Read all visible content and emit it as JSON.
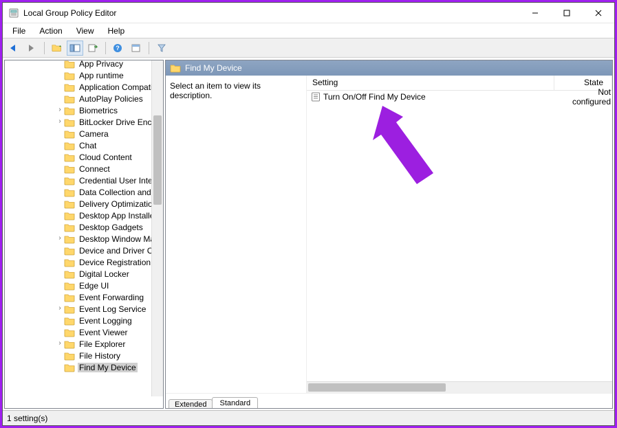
{
  "window": {
    "title": "Local Group Policy Editor"
  },
  "menubar": [
    "File",
    "Action",
    "View",
    "Help"
  ],
  "tree": {
    "indent_base": 70,
    "items": [
      {
        "label": "App Privacy",
        "expandable": false
      },
      {
        "label": "App runtime",
        "expandable": false
      },
      {
        "label": "Application Compati",
        "expandable": false
      },
      {
        "label": "AutoPlay Policies",
        "expandable": false
      },
      {
        "label": "Biometrics",
        "expandable": true
      },
      {
        "label": "BitLocker Drive Encry",
        "expandable": true
      },
      {
        "label": "Camera",
        "expandable": false
      },
      {
        "label": "Chat",
        "expandable": false
      },
      {
        "label": "Cloud Content",
        "expandable": false
      },
      {
        "label": "Connect",
        "expandable": false
      },
      {
        "label": "Credential User Interf",
        "expandable": false
      },
      {
        "label": "Data Collection and P",
        "expandable": false
      },
      {
        "label": "Delivery Optimization",
        "expandable": false
      },
      {
        "label": "Desktop App Installer",
        "expandable": false
      },
      {
        "label": "Desktop Gadgets",
        "expandable": false
      },
      {
        "label": "Desktop Window Ma",
        "expandable": true
      },
      {
        "label": "Device and Driver Co",
        "expandable": false
      },
      {
        "label": "Device Registration",
        "expandable": false
      },
      {
        "label": "Digital Locker",
        "expandable": false
      },
      {
        "label": "Edge UI",
        "expandable": false
      },
      {
        "label": "Event Forwarding",
        "expandable": false
      },
      {
        "label": "Event Log Service",
        "expandable": true
      },
      {
        "label": "Event Logging",
        "expandable": false
      },
      {
        "label": "Event Viewer",
        "expandable": false
      },
      {
        "label": "File Explorer",
        "expandable": true
      },
      {
        "label": "File History",
        "expandable": false
      },
      {
        "label": "Find My Device",
        "expandable": false,
        "selected": true
      }
    ]
  },
  "content": {
    "header_title": "Find My Device",
    "description_prompt": "Select an item to view its description.",
    "columns": {
      "setting": "Setting",
      "state": "State"
    },
    "rows": [
      {
        "setting": "Turn On/Off Find My Device",
        "state": "Not configured"
      }
    ],
    "tabs": {
      "extended": "Extended",
      "standard": "Standard"
    }
  },
  "statusbar": "1 setting(s)"
}
